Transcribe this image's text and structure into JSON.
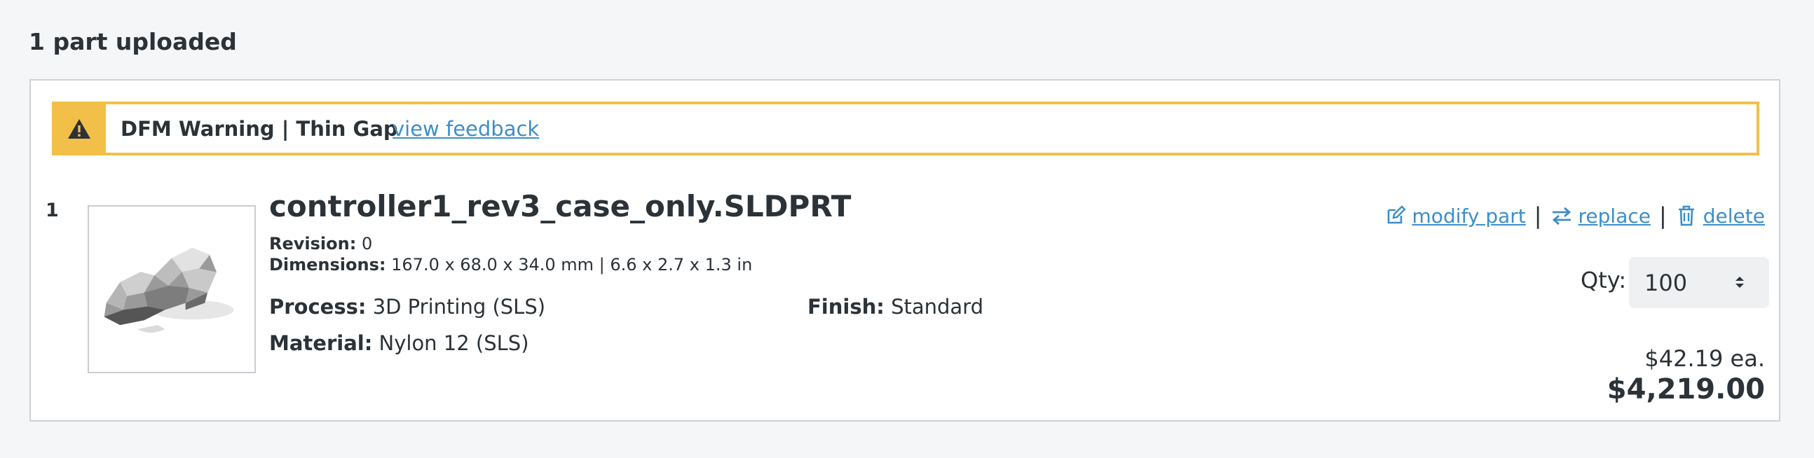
{
  "header": {
    "title": "1 part uploaded"
  },
  "warning": {
    "text": "DFM Warning | Thin Gap",
    "link_label": "view feedback",
    "icon": "warning-triangle-icon",
    "color": "#f2c048"
  },
  "part": {
    "index": "1",
    "name": "controller1_rev3_case_only.SLDPRT",
    "revision_label": "Revision:",
    "revision_value": "0",
    "dimensions_label": "Dimensions:",
    "dimensions_value": "167.0 x 68.0 x 34.0 mm | 6.6 x 2.7 x 1.3 in",
    "process_label": "Process:",
    "process_value": "3D Printing (SLS)",
    "finish_label": "Finish:",
    "finish_value": "Standard",
    "material_label": "Material:",
    "material_value": "Nylon 12 (SLS)"
  },
  "actions": {
    "modify_label": "modify part",
    "replace_label": "replace",
    "delete_label": "delete",
    "separator": "|",
    "link_color": "#3d8ec9"
  },
  "quantity": {
    "label": "Qty:",
    "value": "100"
  },
  "pricing": {
    "unit_price": "$42.19 ea.",
    "total_price": "$4,219.00"
  }
}
